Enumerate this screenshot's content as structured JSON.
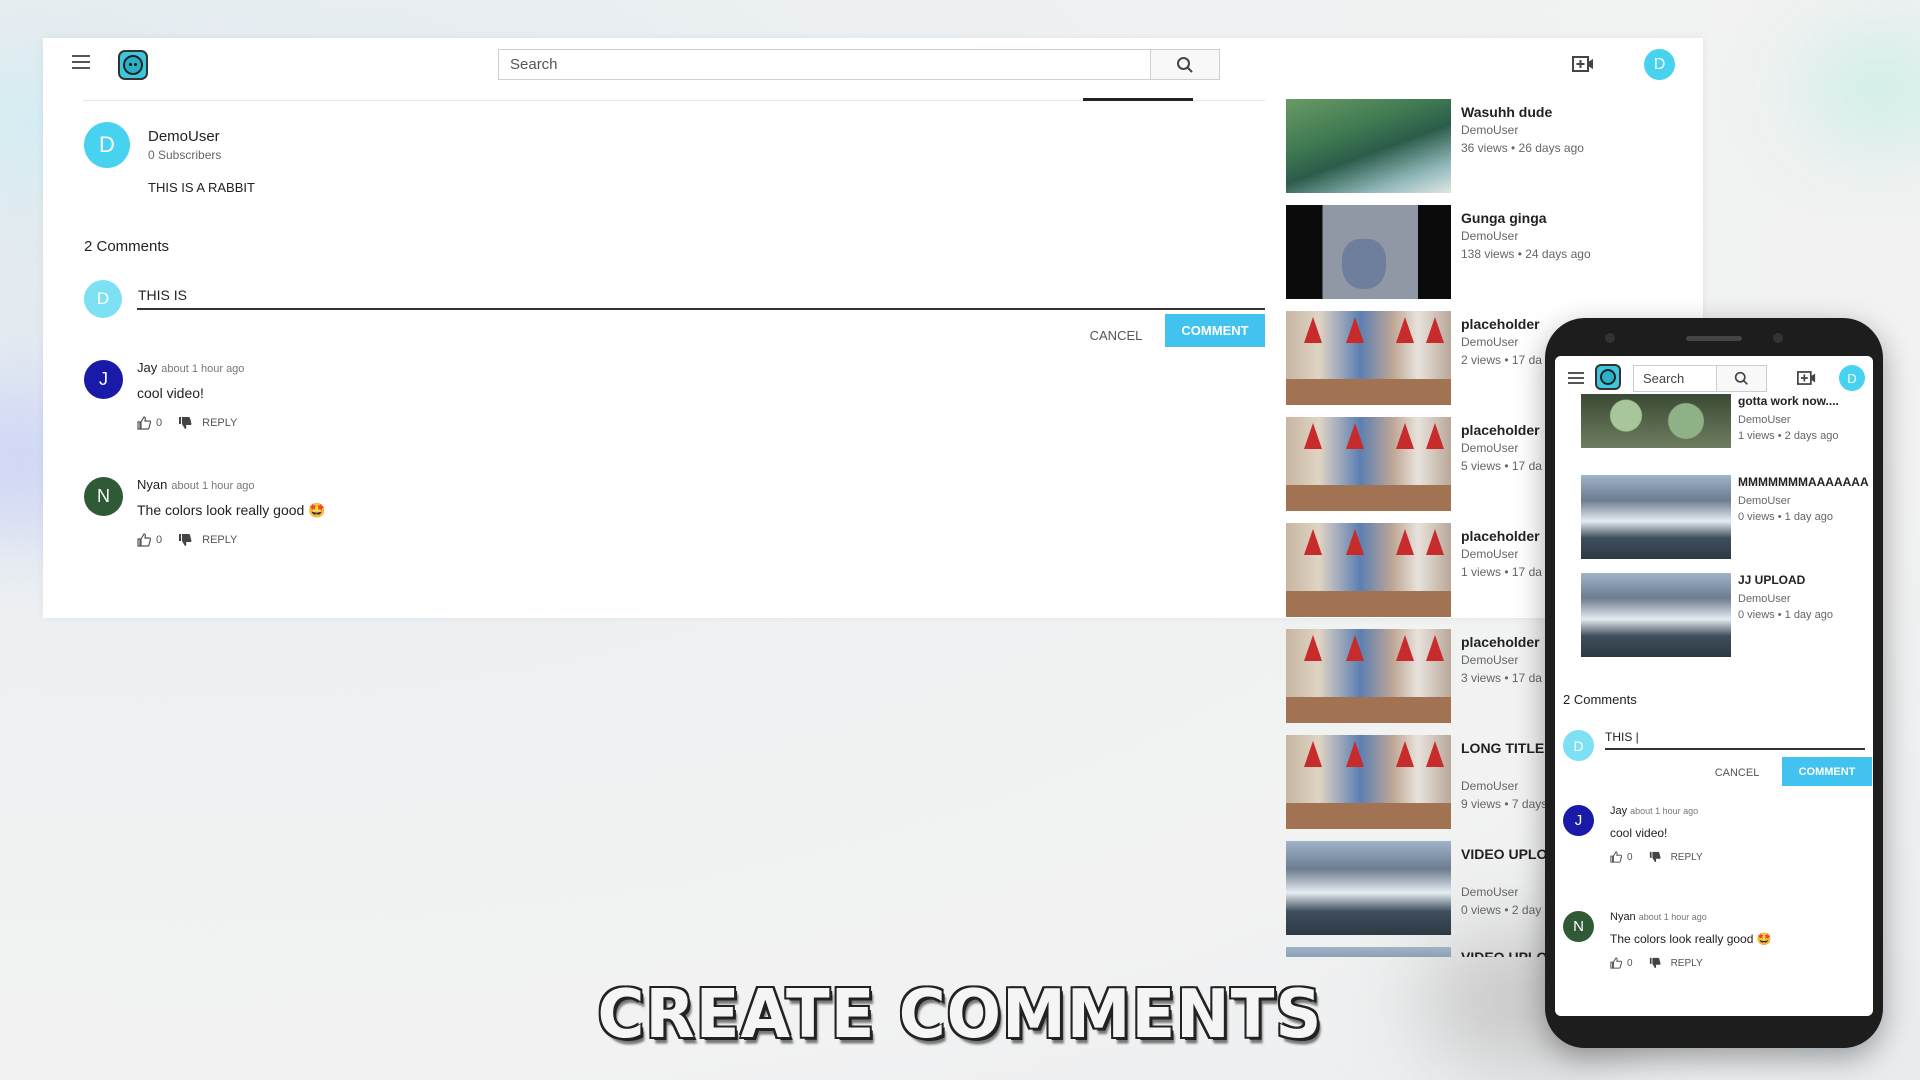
{
  "header": {
    "search_placeholder": "Search",
    "avatar_letter": "D"
  },
  "video_owner": {
    "avatar_letter": "D",
    "name": "DemoUser",
    "subscribers": "0 Subscribers",
    "description": "THIS IS A RABBIT"
  },
  "comments_section": {
    "count_label": "2 Comments",
    "input_avatar_letter": "D",
    "input_value": "THIS IS",
    "cancel_label": "CANCEL",
    "comment_label": "COMMENT",
    "comments": [
      {
        "avatar_letter": "J",
        "avatar_color": "#1a1aa8",
        "author": "Jay",
        "time": "about 1 hour ago",
        "text": "cool video!",
        "likes": "0",
        "reply_label": "REPLY"
      },
      {
        "avatar_letter": "N",
        "avatar_color": "#2f5a35",
        "author": "Nyan",
        "time": "about 1 hour ago",
        "text": "The colors look really good 🤩",
        "likes": "0",
        "reply_label": "REPLY"
      }
    ]
  },
  "sidebar": [
    {
      "title": "Wasuhh dude",
      "channel": "DemoUser",
      "meta": "36 views • 26 days ago",
      "thumb": "wave"
    },
    {
      "title": "Gunga ginga",
      "channel": "DemoUser",
      "meta": "138 views • 24 days ago",
      "thumb": "video"
    },
    {
      "title": "placeholder",
      "channel": "DemoUser",
      "meta": "2 views • 17 da",
      "thumb": "party"
    },
    {
      "title": "placeholder",
      "channel": "DemoUser",
      "meta": "5 views • 17 da",
      "thumb": "party"
    },
    {
      "title": "placeholder",
      "channel": "DemoUser",
      "meta": "1 views • 17 da",
      "thumb": "party"
    },
    {
      "title": "placeholder",
      "channel": "DemoUser",
      "meta": "3 views • 17 da",
      "thumb": "party"
    },
    {
      "title": "LONG TITLE L LONG TITLE L",
      "channel": "DemoUser",
      "meta": "9 views • 7 days",
      "thumb": "party"
    },
    {
      "title": "VIDEO UPLOA NOTI TEST",
      "channel": "DemoUser",
      "meta": "0 views • 2 day",
      "thumb": "mountain"
    },
    {
      "title": "VIDEO UPLO",
      "channel": "",
      "meta": "",
      "thumb": "mountain"
    }
  ],
  "phone": {
    "search_placeholder": "Search",
    "avatar_letter": "D",
    "items": [
      {
        "title": "gotta work now....",
        "channel": "DemoUser",
        "meta": "1 views • 2 days ago",
        "thumb": "broccoli"
      },
      {
        "title": "MMMMMMMAAAAAAA",
        "channel": "DemoUser",
        "meta": "0 views • 1 day ago",
        "thumb": "mountain"
      },
      {
        "title": "JJ UPLOAD",
        "channel": "DemoUser",
        "meta": "0 views • 1 day ago",
        "thumb": "mountain"
      }
    ],
    "count_label": "2 Comments",
    "input_avatar_letter": "D",
    "input_value": "THIS |",
    "cancel_label": "CANCEL",
    "comment_label": "COMMENT",
    "comments": [
      {
        "avatar_letter": "J",
        "avatar_color": "#1a1aa8",
        "author": "Jay",
        "time": "about 1 hour ago",
        "text": "cool video!",
        "likes": "0",
        "reply_label": "REPLY"
      },
      {
        "avatar_letter": "N",
        "avatar_color": "#2f5a35",
        "author": "Nyan",
        "time": "about 1 hour ago",
        "text": "The colors look really good 🤩",
        "likes": "0",
        "reply_label": "REPLY"
      }
    ]
  },
  "caption": "CREATE COMMENTS",
  "colors": {
    "accent": "#42c2ee",
    "avatar": "#47d3f0"
  }
}
